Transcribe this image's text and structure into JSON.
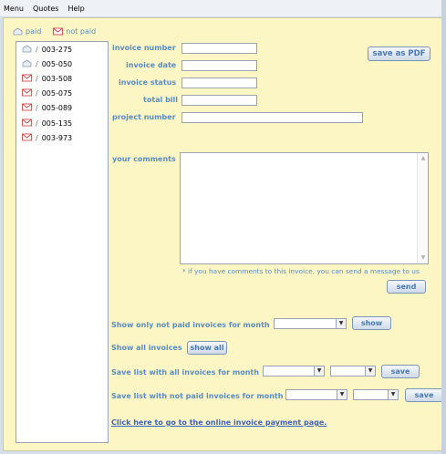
{
  "menubar": {
    "items": [
      "Menu",
      "Quotes",
      "Help"
    ]
  },
  "legend": {
    "paid": "paid",
    "not_paid": "not paid"
  },
  "invoices": [
    {
      "id": "003-275",
      "status": "paid"
    },
    {
      "id": "005-050",
      "status": "paid"
    },
    {
      "id": "003-508",
      "status": "not paid"
    },
    {
      "id": "005-075",
      "status": "not paid"
    },
    {
      "id": "005-089",
      "status": "not paid"
    },
    {
      "id": "005-135",
      "status": "not paid"
    },
    {
      "id": "003-973",
      "status": "not paid"
    }
  ],
  "form": {
    "invoice_number_label": "invoice number",
    "invoice_date_label": "invoice date",
    "invoice_status_label": "invoice status",
    "total_bill_label": "total bill",
    "project_number_label": "project number",
    "comments_label": "your comments",
    "save_pdf": "save as PDF",
    "hint": "* if you have comments to this invoice, you can send a message to us",
    "send": "send"
  },
  "filters": {
    "not_paid_month_label": "Show only not paid invoices for month",
    "show": "show",
    "all_label": "Show all invoices",
    "show_all": "show all",
    "save_all_label": "Save list with all invoices for month",
    "save_notpaid_label": "Save list with not paid invoices for month",
    "save": "save"
  },
  "link": "Click here to go to the online invoice payment page.",
  "colors": {
    "accent": "#5a8cc8",
    "panel": "#fbf6c3",
    "link": "#3f63c4"
  }
}
